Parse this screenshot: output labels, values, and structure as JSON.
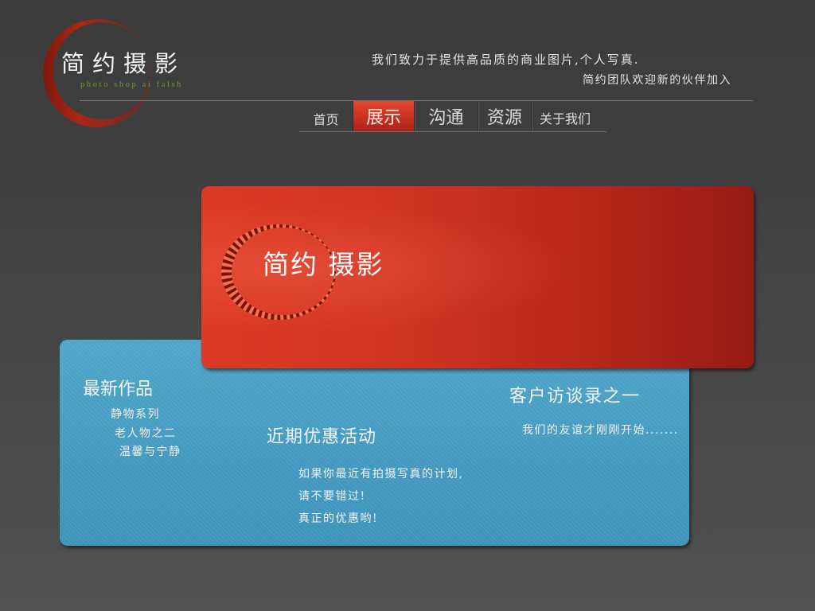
{
  "theme": {
    "background": "#444444",
    "brand_red": "#d63a25",
    "panel_blue": "#4499bf",
    "subtitle_green": "#6d9b2d",
    "text": "#e8e8e8"
  },
  "logo": {
    "title": "简约摄影",
    "subtitle": "photo shop ai falsh",
    "emblem_icon": "red-crescent-icon"
  },
  "header": {
    "tagline_line1": "我们致力于提供高品质的商业图片,个人写真.",
    "tagline_line2": "简约团队欢迎新的伙伴加入"
  },
  "nav": {
    "items": [
      {
        "label": "首页",
        "active": false
      },
      {
        "label": "展示",
        "active": true
      },
      {
        "label": "沟通",
        "active": false
      },
      {
        "label": "资源",
        "active": false
      },
      {
        "label": "关于我们",
        "active": false
      }
    ]
  },
  "banner": {
    "title": "简约 摄影",
    "emblem_icon": "striped-ring-icon"
  },
  "content": {
    "latest_works": {
      "heading": "最新作品",
      "items": [
        "静物系列",
        "老人物之二",
        "温馨与宁静"
      ]
    },
    "promotion": {
      "heading": "近期优惠活动",
      "lines": [
        "如果你最近有拍摄写真的计划,",
        "请不要错过!",
        "真正的优惠哟!"
      ]
    },
    "interview": {
      "heading": "客户访谈录之一",
      "excerpt": "我们的友谊才刚刚开始......."
    }
  }
}
